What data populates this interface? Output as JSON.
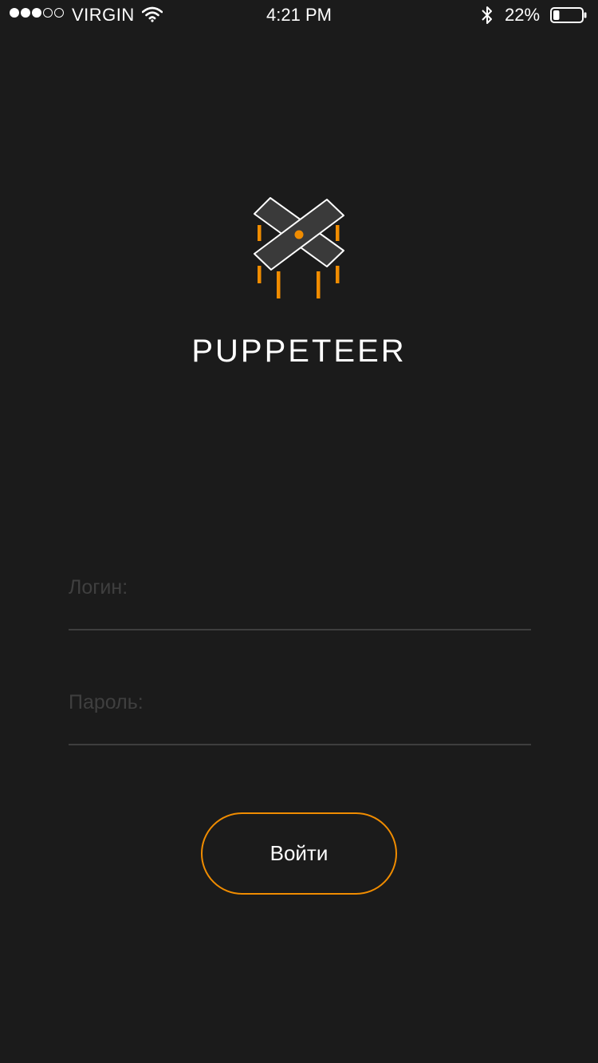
{
  "status_bar": {
    "carrier": "VIRGIN",
    "signal_bars_filled": 3,
    "signal_bars_total": 5,
    "time": "4:21 PM",
    "battery_percent": "22%",
    "battery_level": 0.22,
    "icons": [
      "wifi-icon",
      "bluetooth-icon",
      "battery-icon"
    ]
  },
  "app": {
    "title": "PUPPETEER",
    "logo_icon": "puppeteer-logo-icon"
  },
  "form": {
    "login_placeholder": "Логин:",
    "login_value": "",
    "password_placeholder": "Пароль:",
    "password_value": "",
    "submit_label": "Войти"
  },
  "colors": {
    "background": "#1b1b1b",
    "accent": "#f08c00",
    "divider": "#3e3e3e",
    "placeholder": "#3f3f3f",
    "text": "#ffffff"
  }
}
